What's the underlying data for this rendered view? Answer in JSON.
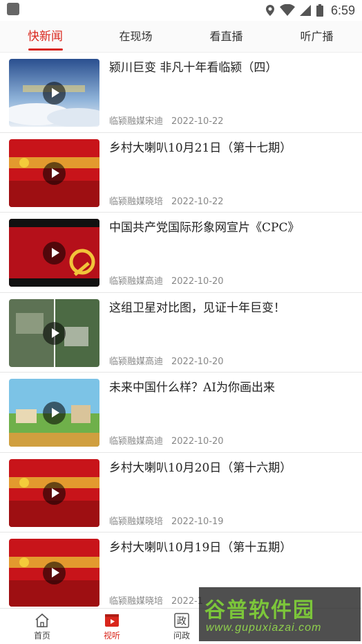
{
  "status_bar": {
    "time": "6:59",
    "icons": [
      "notification-icon",
      "location-icon",
      "wifi-icon",
      "signal-icon",
      "battery-icon"
    ]
  },
  "tabs": [
    {
      "label": "快新闻",
      "active": true
    },
    {
      "label": "在现场",
      "active": false
    },
    {
      "label": "看直播",
      "active": false
    },
    {
      "label": "听广播",
      "active": false
    }
  ],
  "news": [
    {
      "title": "颍川巨变 非凡十年看临颍（四）",
      "source": "临颍融媒宋迪",
      "date": "2022-10-22",
      "thumb": "blue-sky"
    },
    {
      "title": "乡村大喇叭10月21日（第十七期）",
      "source": "临颍融媒晓培",
      "date": "2022-10-22",
      "thumb": "red-banner"
    },
    {
      "title": "中国共产党国际形象网宣片《CPC》",
      "source": "临颍融媒高迪",
      "date": "2022-10-20",
      "thumb": "cpc"
    },
    {
      "title": "这组卫星对比图，见证十年巨变！",
      "source": "临颍融媒高迪",
      "date": "2022-10-20",
      "thumb": "satellite"
    },
    {
      "title": "未来中国什么样？AI为你画出来",
      "source": "临颍融媒高迪",
      "date": "2022-10-20",
      "thumb": "ai-scene"
    },
    {
      "title": "乡村大喇叭10月20日（第十六期）",
      "source": "临颍融媒晓培",
      "date": "2022-10-19",
      "thumb": "red-banner"
    },
    {
      "title": "乡村大喇叭10月19日（第十五期）",
      "source": "临颍融媒晓培",
      "date": "2022-1",
      "thumb": "red-banner"
    }
  ],
  "bottom_nav": [
    {
      "label": "首页",
      "icon": "home-icon",
      "active": false
    },
    {
      "label": "视听",
      "icon": "video-icon",
      "active": true
    },
    {
      "label": "问政",
      "icon": "zheng-icon",
      "active": false
    }
  ],
  "watermark": {
    "logo": "谷普软件园",
    "url": "www.gupuxiazai.com"
  },
  "colors": {
    "accent": "#d9261c",
    "text": "#222222",
    "meta": "#888888"
  }
}
